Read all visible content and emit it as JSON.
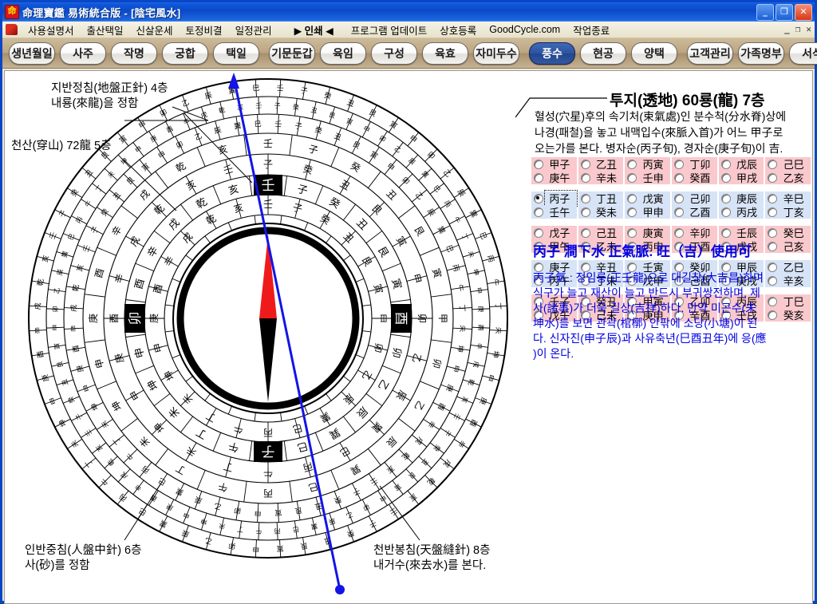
{
  "window": {
    "title": "命理寶鑑 易術統合版 - [陰宅風水]",
    "icon": "app-icon",
    "buttons": [
      {
        "name": "minimize-button",
        "glyph": "_"
      },
      {
        "name": "maximize-button",
        "glyph": "❐"
      },
      {
        "name": "close-button",
        "glyph": "✕"
      }
    ],
    "inner_buttons": [
      {
        "name": "mdi-minimize-button",
        "glyph": "_"
      },
      {
        "name": "mdi-restore-button",
        "glyph": "❐"
      },
      {
        "name": "mdi-close-button",
        "glyph": "✕"
      }
    ]
  },
  "menu": {
    "items": [
      "사용설명서",
      "출산택일",
      "신살운세",
      "토정비결",
      "일정관리",
      "▶ 인쇄 ◀",
      "프로그램 업데이트",
      "상호등록",
      "GoodCycle.com",
      "작업종료"
    ]
  },
  "tabs": {
    "group1": [
      "생년월일",
      "사주",
      "작명",
      "궁합",
      "택일"
    ],
    "group2": [
      "기문둔갑",
      "육임",
      "구성",
      "육효",
      "자미두수"
    ],
    "group3": [
      "풍수",
      "현공",
      "양택"
    ],
    "group4": [
      "고객관리",
      "가족명부",
      "서식"
    ],
    "active": "풍수"
  },
  "annotations": {
    "top_left": "지반정침(地盤正針) 4층\n내룡(來龍)을 정함",
    "mid_left": "천산(穿山) 72龍 5층",
    "bottom_left": "인반중침(人盤中針) 6층\n사(砂)를 정함",
    "bottom_right": "천반봉침(天盤縫針) 8층\n내거수(來去水)를 본다."
  },
  "compass": {
    "cardinal_marks": [
      "壬",
      "卯",
      "酉",
      "子"
    ],
    "ring8": [
      "壬",
      "子",
      "癸",
      "丑",
      "艮",
      "寅",
      "甲",
      "卯",
      "乙",
      "辰",
      "巽",
      "巳",
      "丙",
      "午",
      "丁",
      "未",
      "坤",
      "申",
      "庚",
      "酉",
      "辛",
      "戌",
      "乾",
      "亥"
    ],
    "ring6": [
      "子",
      "癸",
      "丑",
      "艮",
      "寅",
      "甲",
      "卯",
      "乙",
      "辰",
      "巽",
      "巳",
      "丙",
      "午",
      "丁",
      "未",
      "坤",
      "申",
      "庚",
      "酉",
      "辛",
      "戌",
      "乾",
      "亥",
      "壬"
    ],
    "ring4": [
      "壬",
      "子",
      "癸",
      "丑",
      "艮",
      "寅",
      "甲",
      "卯",
      "乙",
      "辰",
      "巽",
      "巳",
      "丙",
      "午",
      "丁",
      "未",
      "坤",
      "申",
      "庚",
      "酉",
      "辛",
      "戌",
      "乾",
      "亥"
    ],
    "needle": {
      "north_color": "#ef1b1b",
      "south_color": "#000000"
    },
    "bearing_line_color": "#1414e6"
  },
  "right_panel": {
    "title": "투지(透地) 60룡(龍) 7층",
    "description": " 혈성(穴星)후의 속기처(束氣處)인 분수척(分水脊)상에\n나경(패철)을 놓고 내맥입수(來脈入首)가 어느 甲子로\n오는가를 본다. 병자순(丙子旬), 경자순(庚子旬)이 吉.",
    "selected": "丙子",
    "blocks": [
      {
        "color": "#f9c9cd",
        "rows": [
          [
            "甲子",
            "乙丑",
            "丙寅",
            "丁卯",
            "戊辰",
            "己巳"
          ],
          [
            "庚午",
            "辛未",
            "壬申",
            "癸酉",
            "甲戌",
            "乙亥"
          ]
        ]
      },
      {
        "color": "#d7e3f6",
        "rows": [
          [
            "丙子",
            "丁丑",
            "戊寅",
            "己卯",
            "庚辰",
            "辛巳"
          ],
          [
            "壬午",
            "癸未",
            "甲申",
            "乙酉",
            "丙戌",
            "丁亥"
          ]
        ]
      },
      {
        "color": "#f9c9cd",
        "rows": [
          [
            "戊子",
            "己丑",
            "庚寅",
            "辛卯",
            "壬辰",
            "癸巳"
          ],
          [
            "甲午",
            "乙未",
            "丙申",
            "丁酉",
            "戊戌",
            "己亥"
          ]
        ]
      },
      {
        "color": "#d7e3f6",
        "rows": [
          [
            "庚子",
            "辛丑",
            "壬寅",
            "癸卯",
            "甲辰",
            "乙巳"
          ],
          [
            "丙午",
            "丁未",
            "戊申",
            "己酉",
            "庚戌",
            "辛亥"
          ]
        ]
      },
      {
        "color": "#f9c9cd",
        "rows": [
          [
            "壬子",
            "癸丑",
            "甲寅",
            "乙卯",
            "丙辰",
            "丁巳"
          ],
          [
            "戊午",
            "己未",
            "庚申",
            "辛酉",
            "壬戌",
            "癸亥"
          ]
        ]
      }
    ],
    "result_heading": "丙子  澗下水  正氣脈.  旺（吉）使用可",
    "result_body": "丙子氣 : 정임룡(正壬龍)으로 대길창(大吉昌)하며\n식구가 늘고 재산이 늘고 반드시 부귀쌍전하며, 제\n사(諸事)가 더욱 길상(吉祥)하다. 만약 미곤수(未\n坤水)를 보면 관곽(棺槨) 안팎에 소당(小塘)이 된\n다. 신자진(申子辰)과 사유축년(巳酉丑年)에 응(應\n)이 온다.",
    "heading_color": "#0000e0"
  }
}
